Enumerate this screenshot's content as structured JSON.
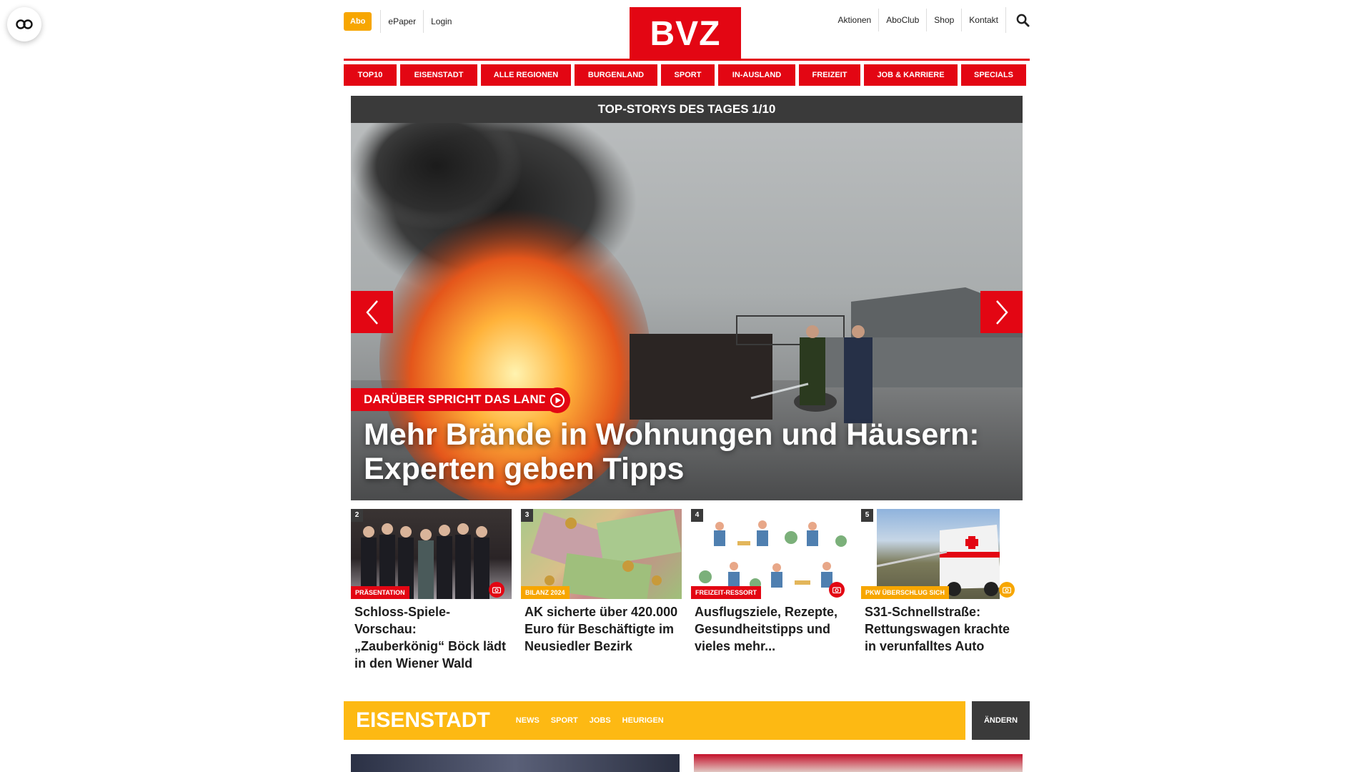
{
  "header": {
    "abo_label": "Abo",
    "left_links": [
      "ePaper",
      "Login"
    ],
    "logo_text": "BVZ",
    "right_links": [
      "Aktionen",
      "AboClub",
      "Shop",
      "Kontakt"
    ],
    "search_icon": "search-icon"
  },
  "nav": {
    "items": [
      "TOP10",
      "EISENSTADT",
      "ALLE REGIONEN",
      "BURGENLAND",
      "SPORT",
      "IN-AUSLAND",
      "FREIZEIT",
      "JOB & KARRIERE",
      "SPECIALS"
    ]
  },
  "hero": {
    "heading": "TOP-STORYS DES TAGES 1/10",
    "kicker": "DARÜBER SPRICHT DAS LAND",
    "title": "Mehr Brände in Wohnungen und Häusern: Experten geben Tipps",
    "prev_icon": "chevron-left-icon",
    "next_icon": "chevron-right-icon",
    "play_icon": "play-icon"
  },
  "teasers": [
    {
      "num": "2",
      "kicker": "PRÄSENTATION",
      "kicker_color": "#e30613",
      "camera": true,
      "cam_color": "#e30613",
      "title": "Schloss-Spiele-Vorschau: „Zauberkönig“ Böck lädt in den Wiener Wald"
    },
    {
      "num": "3",
      "kicker": "BILANZ 2024",
      "kicker_color": "#f7a600",
      "camera": false,
      "cam_color": "",
      "title": "AK sicherte über 420.000 Euro für Beschäftigte im Neusiedler Bezirk"
    },
    {
      "num": "4",
      "kicker": "FREIZEIT-RESSORT",
      "kicker_color": "#e30613",
      "camera": true,
      "cam_color": "#e30613",
      "title": "Ausflugsziele, Rezepte, Gesundheitstipps und vieles mehr..."
    },
    {
      "num": "5",
      "kicker": "PKW ÜBERSCHLUG SICH",
      "kicker_color": "#f7a600",
      "camera": true,
      "cam_color": "#f7a600",
      "title": "S31-Schnellstraße: Rettungswagen krachte in verunfalltes Auto"
    }
  ],
  "region": {
    "title": "EISENSTADT",
    "links": [
      "NEWS",
      "SPORT",
      "JOBS",
      "HEURIGEN"
    ],
    "change_label": "ÄNDERN"
  },
  "colors": {
    "brand_red": "#e30613",
    "abo_orange": "#f7a600",
    "region_yellow": "#fdb913",
    "dark_gray": "#3a3a3a"
  }
}
